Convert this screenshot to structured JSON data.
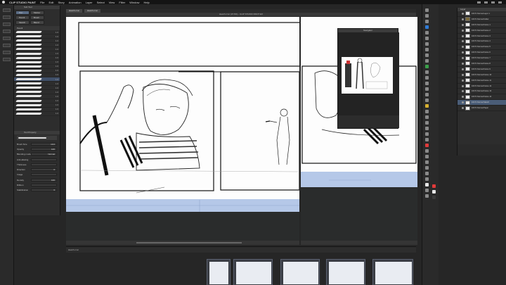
{
  "menubar": {
    "app_name": "CLIP STUDIO PAINT",
    "items": [
      "File",
      "Edit",
      "Story",
      "Animation",
      "Layer",
      "Select",
      "View",
      "Filter",
      "Window",
      "Help"
    ]
  },
  "subtool": {
    "title": "Sub Tool",
    "buttons": [
      "Pen",
      "Marker",
      "Pencil",
      "Brush",
      "Sketch",
      "Blend"
    ],
    "section_title": "Pencil",
    "brushes": [
      {
        "value": "1.0"
      },
      {
        "value": "1.0"
      },
      {
        "value": "1.0"
      },
      {
        "value": "1.0"
      },
      {
        "value": "1.0"
      },
      {
        "value": "1.0"
      },
      {
        "value": "1.0"
      },
      {
        "value": "1.0"
      },
      {
        "value": "1.0"
      },
      {
        "value": "1.0"
      },
      {
        "value": "1.0"
      },
      {
        "value": "1.0"
      },
      {
        "value": "1.0"
      },
      {
        "value": "1.0"
      },
      {
        "value": "1.0"
      },
      {
        "value": "1.0"
      },
      {
        "value": "1.0"
      },
      {
        "value": "1.0"
      },
      {
        "value": "1.0"
      },
      {
        "value": "1.0"
      }
    ]
  },
  "toolprop": {
    "title": "Tool Property",
    "props": [
      {
        "label": "Brush Size",
        "value": "10.0"
      },
      {
        "label": "Opacity",
        "value": "100"
      },
      {
        "label": "Blending mode",
        "value": "Normal"
      },
      {
        "label": "Anti-aliasing",
        "value": ""
      },
      {
        "label": "Thickness",
        "value": ""
      },
      {
        "label": "Direction",
        "value": "0"
      },
      {
        "label": "Image",
        "value": ""
      },
      {
        "label": "Density",
        "value": "100"
      },
      {
        "label": "Ribbon",
        "value": ""
      },
      {
        "label": "Stabilization",
        "value": "6"
      }
    ]
  },
  "document": {
    "tabs": [
      "sketch.cmc",
      "sketch.cmc"
    ],
    "status": "sketch.cmc (47.6%) - CLIP STUDIO PAINT EX",
    "canvasA_title": "sketch.cmc",
    "canvasB_title": "sketch.cmc"
  },
  "navigator": {
    "title": "Navigator"
  },
  "pagestrip": {
    "title": "sketch.cmc"
  },
  "layers": {
    "title": "Layer",
    "rows": [
      {
        "name": "100 % Normal Layer 1"
      },
      {
        "name": "100 % Normal Folder"
      },
      {
        "name": "100 % Normal Frame 1"
      },
      {
        "name": "100 % Normal Frame 2"
      },
      {
        "name": "100 % Normal Frame 3"
      },
      {
        "name": "100 % Normal Frame 4"
      },
      {
        "name": "100 % Normal Frame 5"
      },
      {
        "name": "100 % Normal Frame 6"
      },
      {
        "name": "100 % Normal Frame 7"
      },
      {
        "name": "100 % Normal Frame 8"
      },
      {
        "name": "100 % Normal Frame 9"
      },
      {
        "name": "100 % Normal Frame 10"
      },
      {
        "name": "100 % Normal Frame 11"
      },
      {
        "name": "100 % Normal Frame 12"
      },
      {
        "name": "100 % Normal Frame 13"
      },
      {
        "name": "100 % Normal Frame 14"
      },
      {
        "name": "100 % Normal Sketch"
      },
      {
        "name": "100 % Normal Paper"
      }
    ]
  },
  "colors": {
    "selection": "#4a5d78",
    "canvas_guide_blue": "#b5c8e8",
    "swatches": [
      "#e03a3a",
      "#e8e8e8",
      "#3a3a3a",
      "#2f7bd6",
      "#3aa04a",
      "#d7b030"
    ]
  }
}
